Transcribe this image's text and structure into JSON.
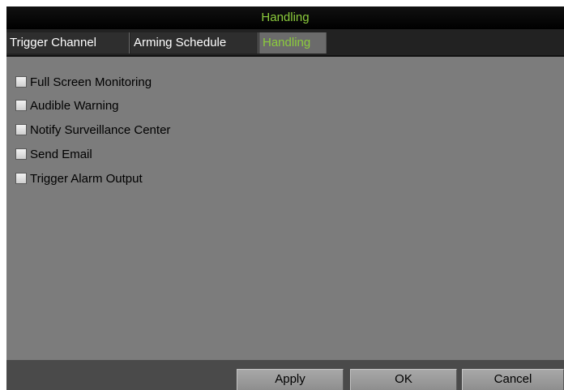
{
  "window": {
    "title": "Handling"
  },
  "tabs": [
    {
      "label": "Trigger Channel"
    },
    {
      "label": "Arming Schedule"
    },
    {
      "label": "Handling"
    }
  ],
  "active_tab": "Handling",
  "options": [
    {
      "label": "Full Screen Monitoring",
      "checked": false
    },
    {
      "label": "Audible Warning",
      "checked": false
    },
    {
      "label": "Notify Surveillance Center",
      "checked": false
    },
    {
      "label": "Send Email",
      "checked": false
    },
    {
      "label": "Trigger Alarm Output",
      "checked": false
    }
  ],
  "buttons": {
    "apply": "Apply",
    "ok": "OK",
    "cancel": "Cancel"
  },
  "colors": {
    "title_text": "#8ccc3c",
    "panel_bg": "#7c7c7c",
    "active_tab_text": "#8ccc3c"
  }
}
